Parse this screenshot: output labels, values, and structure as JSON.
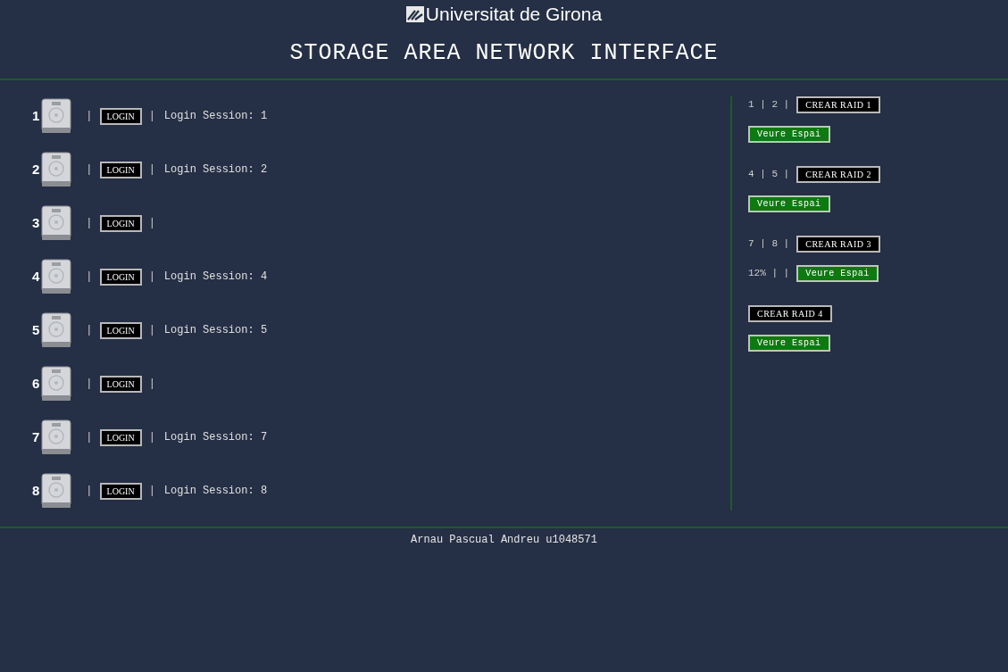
{
  "header": {
    "university": "Universitat de Girona",
    "title": "STORAGE AREA NETWORK INTERFACE"
  },
  "disks": [
    {
      "number": "1",
      "separator_1": "|",
      "button": "LOGIN",
      "separator_2": "|",
      "session": "Login Session: 1"
    },
    {
      "number": "2",
      "separator_1": "|",
      "button": "LOGIN",
      "separator_2": "|",
      "session": "Login Session: 2"
    },
    {
      "number": "3",
      "separator_1": "|",
      "button": "LOGIN",
      "separator_2": "|"
    },
    {
      "number": "4",
      "separator_1": "|",
      "button": "LOGIN",
      "separator_2": "|",
      "session": "Login Session: 4"
    },
    {
      "number": "5",
      "separator_1": "|",
      "button": "LOGIN",
      "separator_2": "|",
      "session": "Login Session: 5"
    },
    {
      "number": "6",
      "separator_1": "|",
      "button": "LOGIN",
      "separator_2": "|"
    },
    {
      "number": "7",
      "separator_1": "|",
      "button": "LOGIN",
      "separator_2": "|",
      "session": "Login Session: 7"
    },
    {
      "number": "8",
      "separator_1": "|",
      "button": "LOGIN",
      "separator_2": "|",
      "session": "Login Session: 8"
    }
  ],
  "raids": [
    {
      "members": "1 | 2 |",
      "button": "CREAR RAID 1",
      "view_button": "Veure Espai"
    },
    {
      "members": "4 | 5 |",
      "button": "CREAR RAID 2",
      "view_button": "Veure Espai"
    },
    {
      "members": "7 | 8 |",
      "button": "CREAR RAID 3",
      "usage": "12% | |",
      "view_button": "Veure Espai"
    },
    {
      "button": "CREAR RAID 4",
      "view_button": "Veure Espai"
    }
  ],
  "footer": "Arnau Pascual Andreu u1048571"
}
